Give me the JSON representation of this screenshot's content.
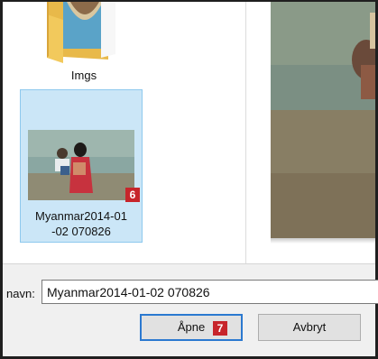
{
  "folder": {
    "label": "Imgs",
    "icon": "folder-icon"
  },
  "selected_item": {
    "label_line1": "Myanmar2014-01",
    "label_line2": "-02 070826",
    "badge": "6"
  },
  "filename": {
    "label": "navn:",
    "value": "Myanmar2014-01-02 070826"
  },
  "buttons": {
    "open_label": "Åpne",
    "open_badge": "7",
    "cancel_label": "Avbryt"
  },
  "colors": {
    "selection": "#cbe6f7",
    "badge": "#c7252b",
    "focus_border": "#2b79d0"
  }
}
